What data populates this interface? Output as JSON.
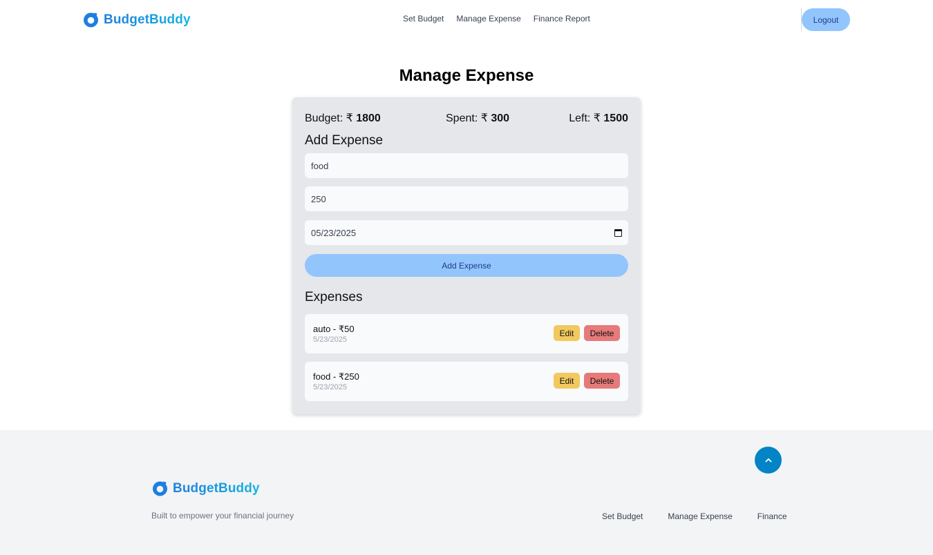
{
  "header": {
    "logo_text": "BudgetBuddy",
    "nav": [
      "Set Budget",
      "Manage Expense",
      "Finance Report"
    ],
    "logout_label": "Logout"
  },
  "page": {
    "title": "Manage Expense"
  },
  "summary": {
    "budget_label": "Budget: ₹ ",
    "budget_value": "1800",
    "spent_label": "Spent: ₹ ",
    "spent_value": "300",
    "left_label": "Left: ₹ ",
    "left_value": "1500"
  },
  "form": {
    "title": "Add Expense",
    "name_value": "food",
    "amount_value": "250",
    "date_value": "05/23/2025",
    "submit_label": "Add Expense"
  },
  "expenses": {
    "title": "Expenses",
    "items": [
      {
        "name": "auto - ₹50",
        "date": "5/23/2025"
      },
      {
        "name": "food - ₹250",
        "date": "5/23/2025"
      }
    ],
    "edit_label": "Edit",
    "delete_label": "Delete"
  },
  "footer": {
    "logo_text": "BudgetBuddy",
    "tagline": "Built to empower your financial journey",
    "links": [
      "Set Budget",
      "Manage Expense",
      "Finance"
    ]
  },
  "colors": {
    "brand_blue": "#1d7fe0",
    "button_blue": "#93c5fd",
    "edit_yellow": "#f1c95f",
    "delete_red": "#e67a7a",
    "scroll_top_blue": "#0284c7"
  },
  "icons": {
    "logo": "budgetbuddy-logo-icon",
    "calendar": "calendar-icon",
    "scroll_top": "chevron-up-icon"
  }
}
